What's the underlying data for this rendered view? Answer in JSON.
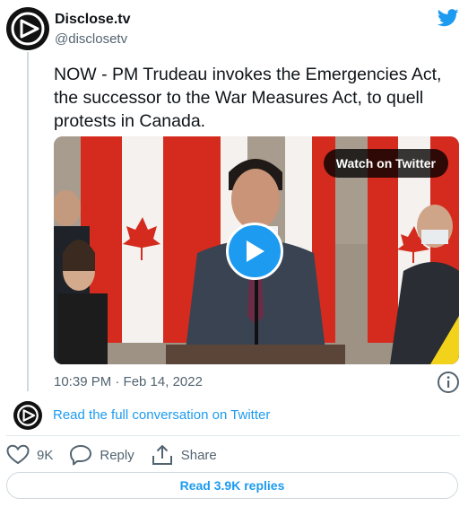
{
  "author": {
    "name": "Disclose.tv",
    "handle": "@disclosetv"
  },
  "tweet": {
    "text": "NOW - PM Trudeau invokes the Emergencies Act, the successor to the War Measures Act, to quell protests in Canada.",
    "timestamp": "10:39 PM · Feb 14, 2022"
  },
  "media": {
    "watch_label": "Watch on Twitter"
  },
  "conversation": {
    "read_full_label": "Read the full conversation on Twitter"
  },
  "actions": {
    "likes_count": "9K",
    "reply_label": "Reply",
    "share_label": "Share"
  },
  "replies": {
    "read_replies_label": "Read 3.9K replies"
  },
  "colors": {
    "accent": "#1d9bf0",
    "text": "#0f1419",
    "muted": "#536471"
  },
  "icons": [
    "disclose-logo-icon",
    "twitter-bird-icon",
    "play-icon",
    "info-icon",
    "heart-icon",
    "reply-icon",
    "share-icon"
  ]
}
